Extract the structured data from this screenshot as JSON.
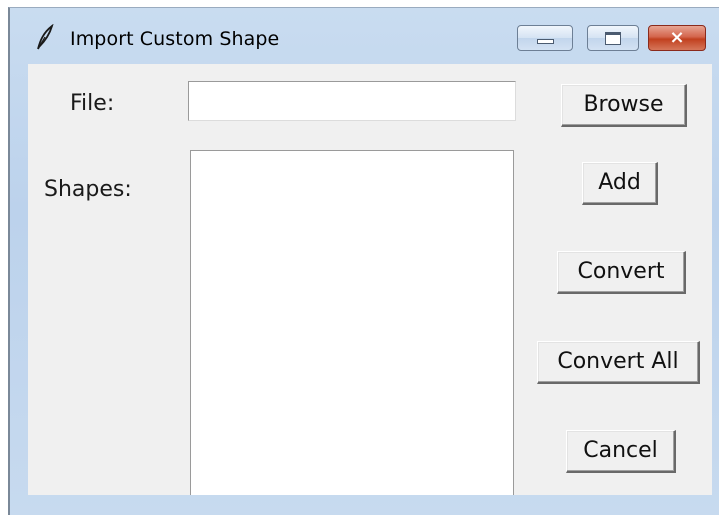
{
  "window": {
    "title": "Import Custom Shape",
    "app_icon": "feather-icon",
    "controls": {
      "minimize": "minimize-icon",
      "maximize": "maximize-icon",
      "close": "close-icon",
      "close_glyph": "×"
    }
  },
  "form": {
    "file_label": "File:",
    "file_value": "",
    "shapes_label": "Shapes:",
    "shapes": []
  },
  "buttons": {
    "browse": "Browse",
    "add": "Add",
    "convert": "Convert",
    "convert_all": "Convert All",
    "cancel": "Cancel"
  },
  "colors": {
    "titlebar": "#bcd2ec",
    "client": "#f0f0f0",
    "close_button": "#c1401f"
  }
}
